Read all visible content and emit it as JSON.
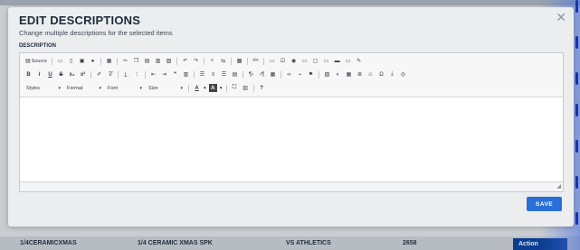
{
  "modal": {
    "title": "EDIT DESCRIPTIONS",
    "subtitle": "Change multiple descriptions for the selected items",
    "field_label": "DESCRIPTION",
    "close_glyph": "✕",
    "save_label": "SAVE"
  },
  "toolbar": {
    "source_label": "Source",
    "row1_icons": [
      "save-icon",
      "new-page-icon",
      "preview-icon",
      "print-icon",
      "templates-icon",
      "cut-icon",
      "copy-icon",
      "paste-icon",
      "paste-text-icon",
      "paste-word-icon",
      "undo-icon",
      "redo-icon",
      "find-icon",
      "replace-icon",
      "select-all-icon",
      "spellcheck-icon",
      "form-icon",
      "checkbox-icon",
      "radio-icon",
      "textfield-icon",
      "textarea-icon",
      "select-icon",
      "button-icon",
      "image-button-icon",
      "hidden-field-icon"
    ],
    "row2_format": [
      "B",
      "I",
      "U",
      "S",
      "x₂",
      "x²"
    ],
    "row3_selects": [
      {
        "name": "styles",
        "label": "Styles"
      },
      {
        "name": "format",
        "label": "Format"
      },
      {
        "name": "font",
        "label": "Font"
      },
      {
        "name": "size",
        "label": "Size"
      }
    ],
    "help_label": "?"
  },
  "background": {
    "row_col1": "1/4CERAMICXMAS",
    "row_col2": "1/4 CERAMIC XMAS SPK",
    "row_col3": "VS ATHLETICS",
    "row_col4": "2658",
    "action_label": "Action"
  }
}
